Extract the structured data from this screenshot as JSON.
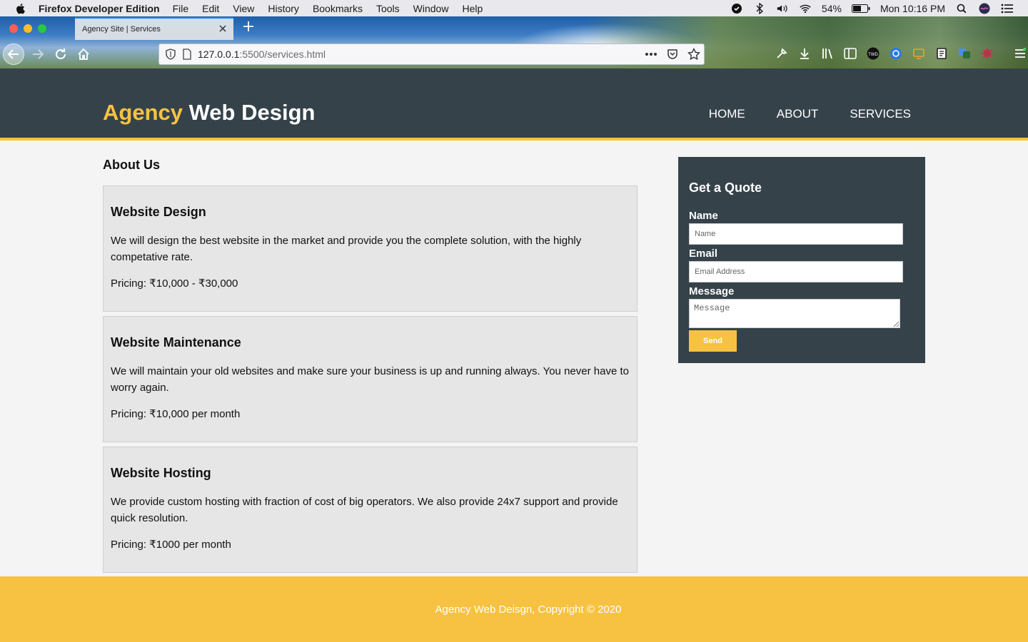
{
  "os_menubar": {
    "app_name": "Firefox Developer Edition",
    "menus": [
      "File",
      "Edit",
      "View",
      "History",
      "Bookmarks",
      "Tools",
      "Window",
      "Help"
    ],
    "battery": "54%",
    "clock": "Mon 10:16 PM"
  },
  "browser": {
    "tab_title": "Agency Site | Services",
    "url_host": "127.0.0.1",
    "url_path": ":5500/services.html"
  },
  "site": {
    "logo_highlight": "Agency",
    "logo_rest": "Web Design",
    "nav": [
      "HOME",
      "ABOUT",
      "SERVICES"
    ],
    "page_heading": "About Us",
    "services": [
      {
        "title": "Website Design",
        "description": "We will design the best website in the market and provide you the complete solution, with the highly competative rate.",
        "pricing": "Pricing: ₹10,000 - ₹30,000"
      },
      {
        "title": "Website Maintenance",
        "description": "We will maintain your old websites and make sure your business is up and running always. You never have to worry again.",
        "pricing": "Pricing: ₹10,000 per month"
      },
      {
        "title": "Website Hosting",
        "description": "We provide custom hosting with fraction of cost of big operators. We also provide 24x7 support and provide quick resolution.",
        "pricing": "Pricing: ₹1000 per month"
      }
    ],
    "quote_form": {
      "title": "Get a Quote",
      "name_label": "Name",
      "name_placeholder": "Name",
      "email_label": "Email",
      "email_placeholder": "Email Address",
      "message_label": "Message",
      "message_placeholder": "Message",
      "send_label": "Send"
    },
    "footer": "Agency Web Deisgn, Copyright © 2020"
  },
  "colors": {
    "header_bg": "#35424a",
    "accent": "#f7c242",
    "page_bg": "#f4f4f4",
    "card_bg": "#e6e6e6"
  }
}
